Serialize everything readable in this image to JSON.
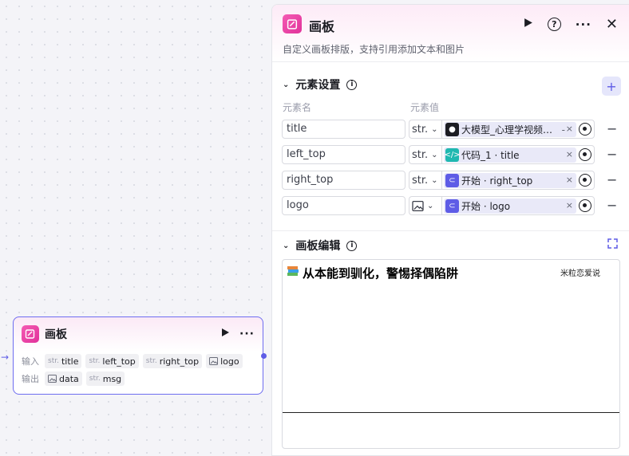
{
  "node": {
    "title": "画板",
    "input_label": "输入",
    "output_label": "输出",
    "inputs": [
      {
        "type": "str.",
        "name": "title"
      },
      {
        "type": "str.",
        "name": "left_top"
      },
      {
        "type": "str.",
        "name": "right_top"
      },
      {
        "type": "image",
        "name": "logo"
      }
    ],
    "outputs": [
      {
        "type": "image",
        "name": "data"
      },
      {
        "type": "str.",
        "name": "msg"
      }
    ]
  },
  "panel": {
    "title": "画板",
    "description": "自定义画板排版，支持引用添加文本和图片",
    "elements_section": "元素设置",
    "col_name": "元素名",
    "col_value": "元素值",
    "rows": [
      {
        "name": "title",
        "type": "str.",
        "ref": "大模型_心理学视频…",
        "ref_suffix": "-",
        "ref_icon": "model-icon",
        "ref_color": "#1c1d23"
      },
      {
        "name": "left_top",
        "type": "str.",
        "ref": "代码_1 · title",
        "ref_suffix": "",
        "ref_icon": "code-icon",
        "ref_color": "#1fb8b0"
      },
      {
        "name": "right_top",
        "type": "str.",
        "ref": "开始 · right_top",
        "ref_suffix": "",
        "ref_icon": "start-icon",
        "ref_color": "#5e5ce6"
      },
      {
        "name": "logo",
        "type": "image",
        "ref": "开始 · logo",
        "ref_suffix": "",
        "ref_icon": "start-icon",
        "ref_color": "#5e5ce6"
      }
    ],
    "canvas_section": "画板编辑",
    "canvas": {
      "title_text": "从本能到驯化，警惕择偶陷阱",
      "logo_text": "米粒恋爱说"
    }
  },
  "colors": {
    "accent": "#5e5ce6",
    "brand_pink": "#e1319a"
  }
}
